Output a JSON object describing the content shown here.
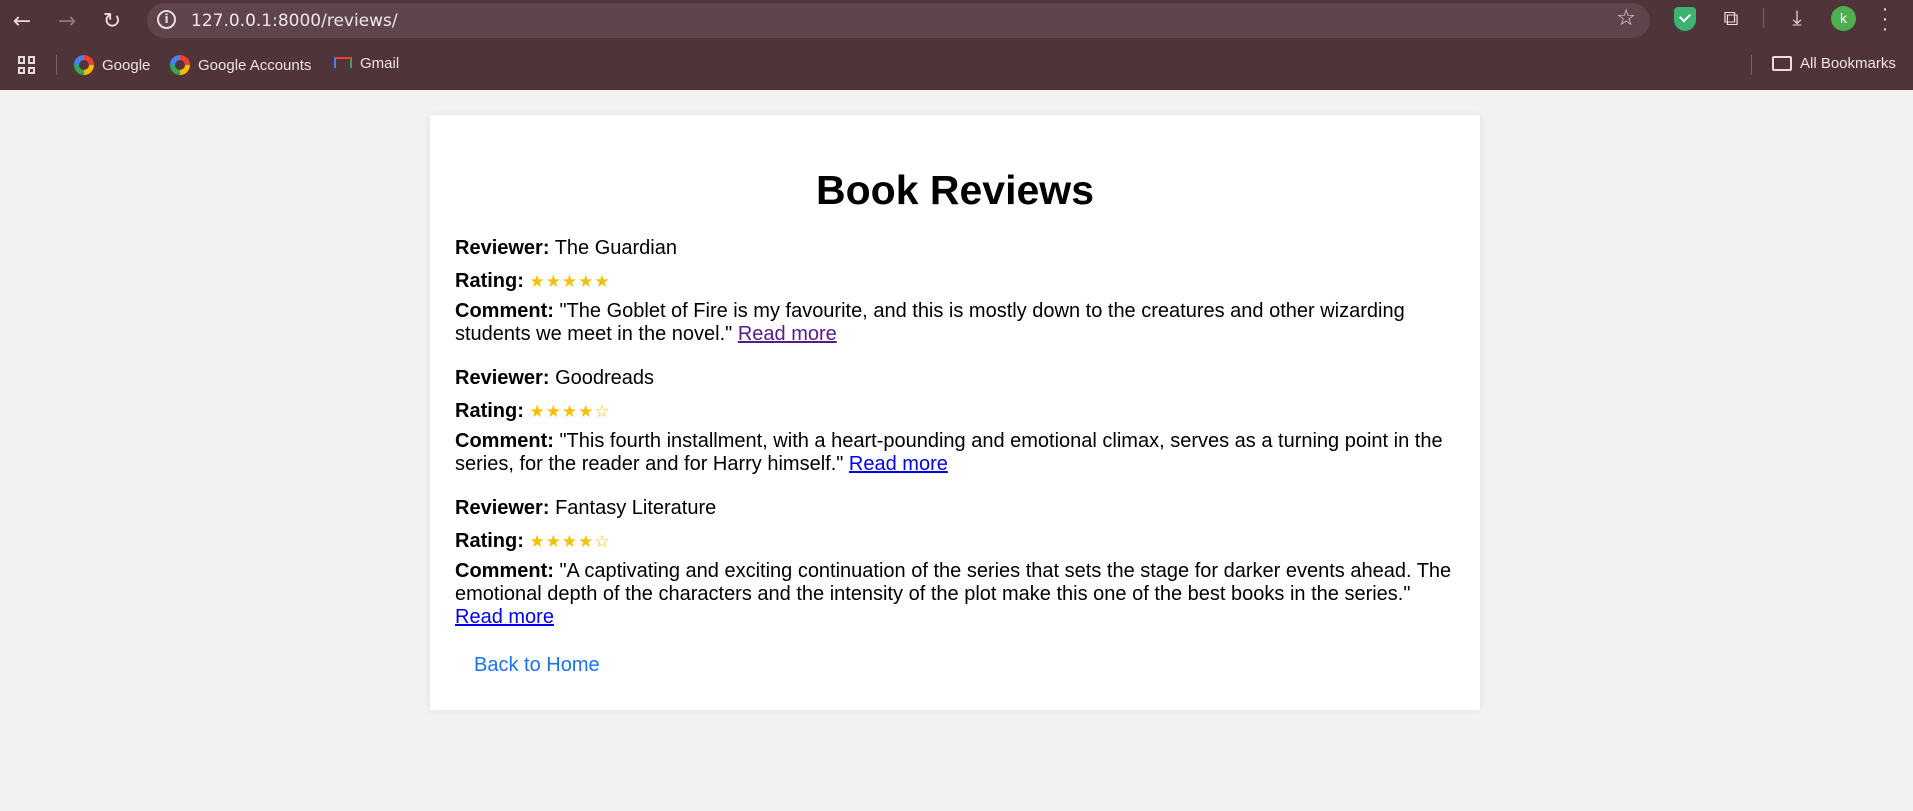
{
  "browser": {
    "url": "127.0.0.1:8000/reviews/",
    "avatar_letter": "k",
    "bookmarks": [
      {
        "label": "Google",
        "icon": "google-icon"
      },
      {
        "label": "Google Accounts",
        "icon": "google-icon"
      },
      {
        "label": "Gmail",
        "icon": "gmail-icon"
      }
    ],
    "all_bookmarks_label": "All Bookmarks"
  },
  "page": {
    "title": "Book Reviews",
    "reviewer_label": "Reviewer:",
    "rating_label": "Rating:",
    "comment_label": "Comment:",
    "read_more_label": "Read more",
    "back_label": "Back to Home",
    "reviews": [
      {
        "reviewer": "The Guardian",
        "rating_stars": "★★★★★",
        "rating": 5,
        "comment": "\"The Goblet of Fire is my favourite, and this is mostly down to the creatures and other wizarding students we meet in the novel.\""
      },
      {
        "reviewer": "Goodreads",
        "rating_stars": "★★★★☆",
        "rating": 4,
        "comment": "\"This fourth installment, with a heart-pounding and emotional climax, serves as a turning point in the series, for the reader and for Harry himself.\""
      },
      {
        "reviewer": "Fantasy Literature",
        "rating_stars": "★★★★☆",
        "rating": 4,
        "comment": "\"A captivating and exciting continuation of the series that sets the stage for darker events ahead. The emotional depth of the characters and the intensity of the plot make this one of the best books in the series.\""
      }
    ]
  },
  "colors": {
    "chrome_bg": "#4f343a",
    "star": "#f2c200",
    "link": "#0000ee",
    "visited_link": "#551a8b",
    "back_link": "#1a73e8"
  }
}
